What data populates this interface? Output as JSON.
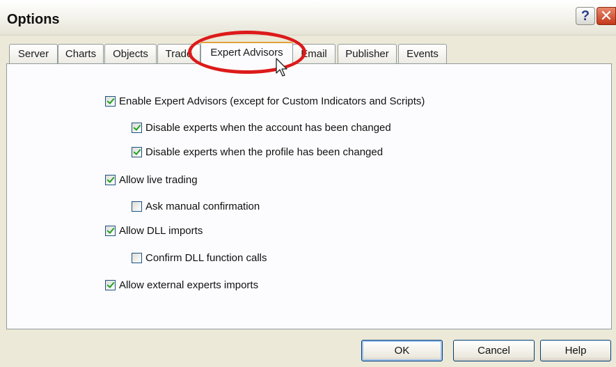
{
  "window": {
    "title": "Options",
    "help_glyph": "?",
    "close_glyph": "✕"
  },
  "tabs": [
    {
      "label": "Server",
      "active": false
    },
    {
      "label": "Charts",
      "active": false
    },
    {
      "label": "Objects",
      "active": false
    },
    {
      "label": "Trade",
      "active": false
    },
    {
      "label": "Expert Advisors",
      "active": true
    },
    {
      "label": "Email",
      "active": false
    },
    {
      "label": "Publisher",
      "active": false
    },
    {
      "label": "Events",
      "active": false
    }
  ],
  "options": [
    {
      "label": "Enable Expert Advisors (except for Custom Indicators and Scripts)",
      "checked": true
    },
    {
      "label": "Disable experts when the account has been changed",
      "checked": true
    },
    {
      "label": "Disable experts when the profile has been changed",
      "checked": true
    },
    {
      "label": "Allow live trading",
      "checked": true
    },
    {
      "label": "Ask manual confirmation",
      "checked": false
    },
    {
      "label": "Allow DLL imports",
      "checked": true
    },
    {
      "label": "Confirm DLL function calls",
      "checked": false
    },
    {
      "label": "Allow external experts imports",
      "checked": true
    }
  ],
  "buttons": {
    "ok": "OK",
    "cancel": "Cancel",
    "help": "Help"
  },
  "annotation": {
    "highlight_color": "#dd1a1a",
    "highlighted_tab": "Expert Advisors"
  },
  "icons": {
    "cursor": "arrow-cursor-icon",
    "help": "question-icon",
    "close": "close-icon"
  }
}
